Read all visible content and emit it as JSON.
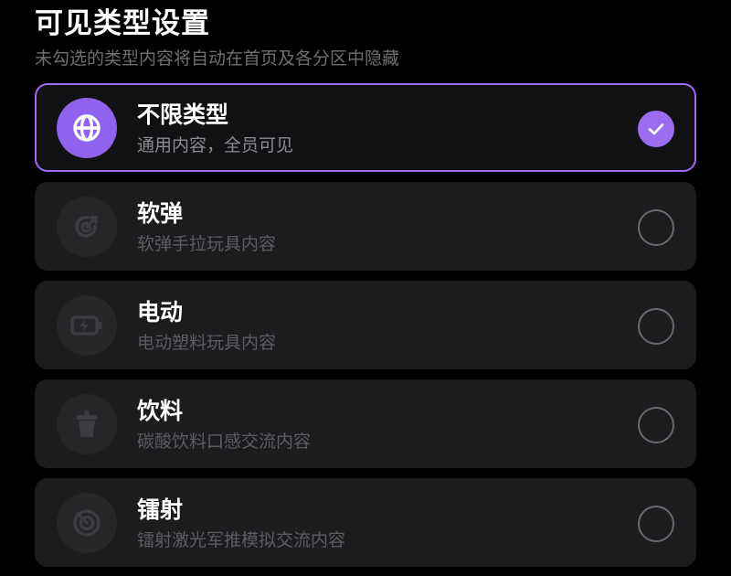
{
  "header": {
    "title": "可见类型设置",
    "subtitle": "未勾选的类型内容将自动在首页及各分区中隐藏"
  },
  "options": [
    {
      "label": "不限类型",
      "desc": "通用内容，全员可见",
      "icon": "globe-icon",
      "selected": true
    },
    {
      "label": "软弹",
      "desc": "软弹手拉玩具内容",
      "icon": "target-icon",
      "selected": false
    },
    {
      "label": "电动",
      "desc": "电动塑料玩具内容",
      "icon": "battery-charging-icon",
      "selected": false
    },
    {
      "label": "饮料",
      "desc": "碳酸饮料口感交流内容",
      "icon": "cup-icon",
      "selected": false
    },
    {
      "label": "镭射",
      "desc": "镭射激光军推模拟交流内容",
      "icon": "laser-icon",
      "selected": false
    }
  ],
  "colors": {
    "accent": "#9b6cf0",
    "background": "#000000",
    "card": "#1c1c1e"
  }
}
